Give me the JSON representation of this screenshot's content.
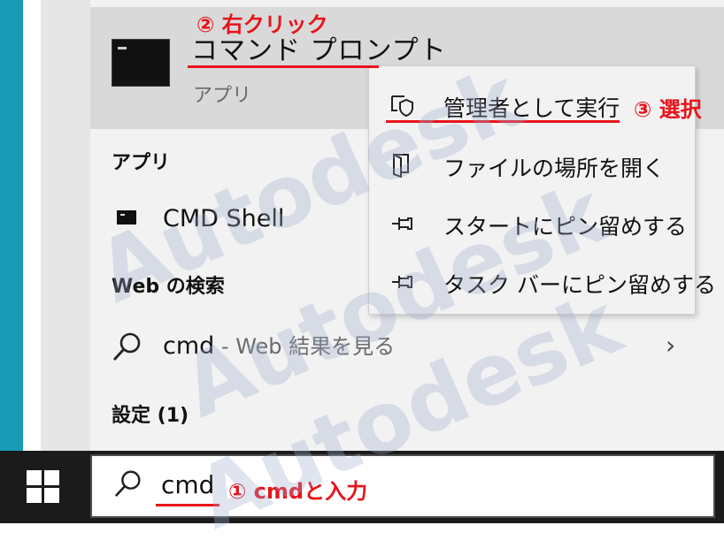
{
  "best_match": {
    "title": "コマンド プロンプト",
    "subtitle": "アプリ"
  },
  "sections": {
    "apps": "アプリ",
    "web_search": "Web の検索",
    "settings": "設定 (1)"
  },
  "apps": [
    {
      "label": "CMD Shell"
    }
  ],
  "web_result": {
    "query": "cmd",
    "suffix": " - Web 結果を見る"
  },
  "context_menu": {
    "items": [
      {
        "label": "管理者として実行",
        "icon": "shield-run-as-admin-icon"
      },
      {
        "label": "ファイルの場所を開く",
        "icon": "folder-open-icon"
      },
      {
        "label": "スタートにピン留めする",
        "icon": "pin-icon"
      },
      {
        "label": "タスク バーにピン留めする",
        "icon": "pin-icon"
      }
    ]
  },
  "search": {
    "value": "cmd"
  },
  "annotations": {
    "step1": "① cmdと入力",
    "step2": "② 右クリック",
    "step3": "③ 選択"
  },
  "watermark": "Autodesk",
  "colors": {
    "annotation": "#e8131b",
    "taskbar": "#1b1b1b",
    "desktop_accent": "#1a9bb5"
  }
}
